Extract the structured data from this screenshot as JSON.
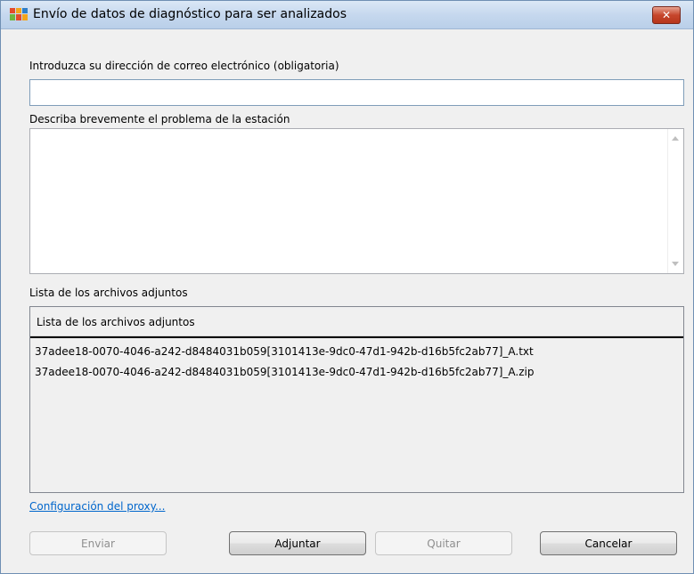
{
  "window": {
    "title": "Envío de datos de diagnóstico para ser analizados",
    "close_glyph": "✕"
  },
  "form": {
    "email_label": "Introduzca su dirección de correo electrónico (obligatoria)",
    "email_value": "",
    "description_label": "Describa brevemente el problema de la estación",
    "description_value": "",
    "attachments_label": "Lista de los archivos adjuntos"
  },
  "attachments": {
    "column_header": "Lista de los archivos adjuntos",
    "files": [
      "37adee18-0070-4046-a242-d8484031b059[3101413e-9dc0-47d1-942b-d16b5fc2ab77]_A.txt",
      "37adee18-0070-4046-a242-d8484031b059[3101413e-9dc0-47d1-942b-d16b5fc2ab77]_A.zip"
    ]
  },
  "proxy_link": "Configuración del proxy...",
  "buttons": {
    "send": "Enviar",
    "attach": "Adjuntar",
    "remove": "Quitar",
    "cancel": "Cancelar"
  },
  "icons": {
    "app": "avg-logo-icon",
    "close": "close-icon",
    "scroll_up": "scroll-up-arrow-icon",
    "scroll_down": "scroll-down-arrow-icon"
  }
}
